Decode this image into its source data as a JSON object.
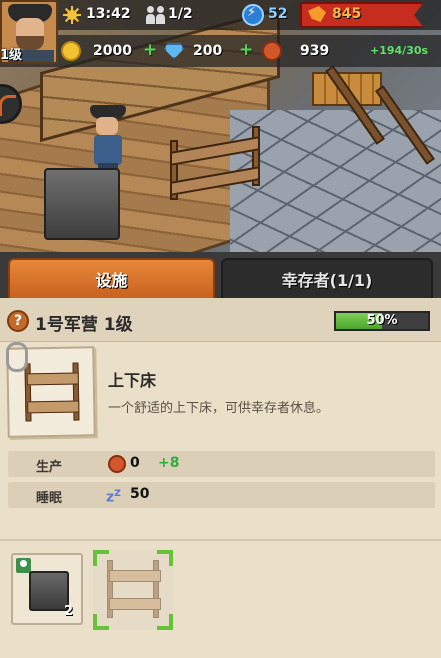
{
  "hud": {
    "time": "13:42",
    "population": "1/2",
    "energy": "52",
    "power": "845",
    "level": "1级",
    "coins": "2000",
    "gems": "200",
    "chips": "939",
    "rate": "+194/30s"
  },
  "tabs": [
    {
      "label": "设施"
    },
    {
      "label": "幸存者(1/1)"
    }
  ],
  "panel": {
    "title": "1号军营 1级",
    "progress_label": "50%",
    "progress": 0.5,
    "help_icon": "?",
    "item": {
      "name": "上下床",
      "description": "一个舒适的上下床，可供幸存者休息。"
    },
    "stats": [
      {
        "label": "生产",
        "icon": "chip-icon",
        "value": "0",
        "delta": "+8"
      },
      {
        "label": "睡眠",
        "icon": "sleep-icon",
        "value": "50"
      }
    ],
    "slots": [
      {
        "name": "machine",
        "count": "2"
      },
      {
        "name": "bunk-bed",
        "selected": true
      }
    ]
  },
  "colors": {
    "tab_active": "#e07a2e",
    "progress_fill": "#5fb93a",
    "positive": "#2fae3a",
    "power_bar": "#c62d1f"
  }
}
